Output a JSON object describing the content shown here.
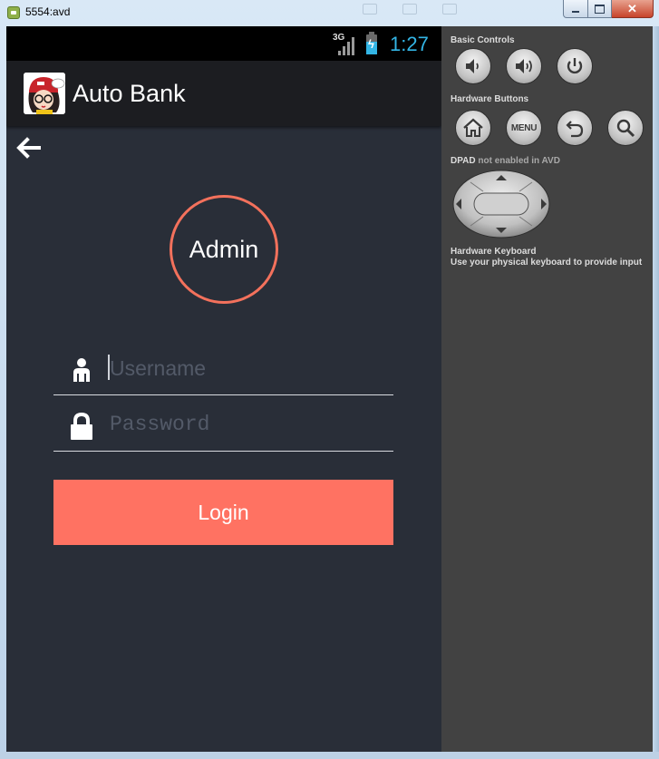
{
  "window": {
    "title": "5554:avd",
    "controls": {
      "minimize": "minimize",
      "maximize": "maximize",
      "close": "✕"
    }
  },
  "status_bar": {
    "network": "3G",
    "time": "1:27",
    "accent_color": "#33b5e5"
  },
  "action_bar": {
    "app_title": "Auto Bank"
  },
  "login": {
    "avatar_label": "Admin",
    "username_placeholder": "Username",
    "password_placeholder": "Password",
    "login_button": "Login",
    "accent_color": "#ff7262"
  },
  "emulator_panel": {
    "basic_controls": "Basic Controls",
    "hardware_buttons": "Hardware Buttons",
    "menu_label": "MENU",
    "dpad_label": "DPAD",
    "dpad_note": "not enabled in AVD",
    "keyboard_title": "Hardware Keyboard",
    "keyboard_note": "Use your physical keyboard to provide input",
    "icons": [
      "volume-down-icon",
      "volume-up-icon",
      "power-icon",
      "home-icon",
      "menu-icon",
      "back-icon",
      "search-icon",
      "dpad-icon"
    ]
  }
}
